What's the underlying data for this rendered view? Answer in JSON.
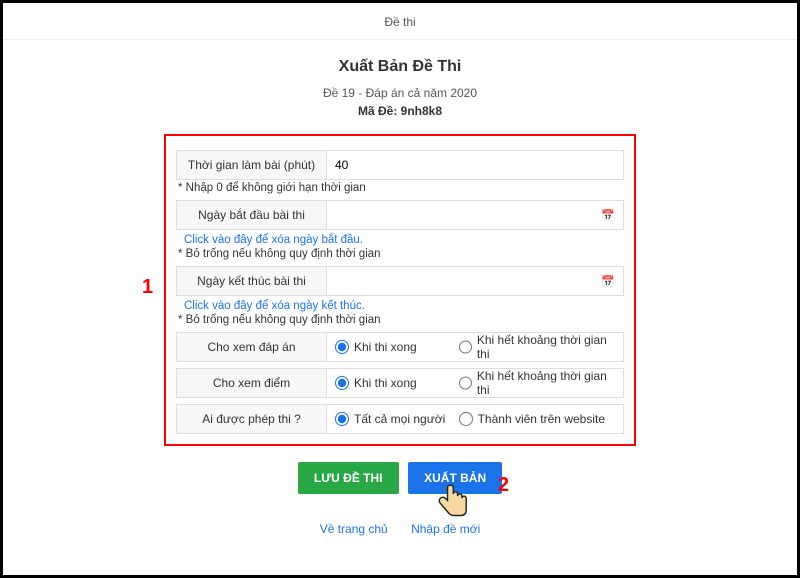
{
  "header": {
    "breadcrumb": "Đề thi"
  },
  "title": "Xuất Bản Đề Thi",
  "subtitle": "Đề 19 - Đáp án cả năm 2020",
  "exam_code_label": "Mã Đề:",
  "exam_code": "9nh8k8",
  "fields": {
    "duration": {
      "label": "Thời gian làm bài (phút)",
      "value": "40",
      "note": "* Nhập 0 để không giới hạn thời gian"
    },
    "start": {
      "label": "Ngày bắt đầu bài thi",
      "value": "",
      "clear_link": "Click vào đây để xóa ngày bắt đầu.",
      "note": "* Bỏ trống nếu không quy định thời gian"
    },
    "end": {
      "label": "Ngày kết thúc bài thi",
      "value": "",
      "clear_link": "Click vào đây để xóa ngày kết thúc.",
      "note": "* Bỏ trống nếu không quy định thời gian"
    },
    "show_answer": {
      "label": "Cho xem đáp án",
      "opt1": "Khi thi xong",
      "opt2": "Khi hết khoảng thời gian thi"
    },
    "show_score": {
      "label": "Cho xem điểm",
      "opt1": "Khi thi xong",
      "opt2": "Khi hết khoảng thời gian thi"
    },
    "who": {
      "label": "Ai được phép thi ?",
      "opt1": "Tất cả mọi người",
      "opt2": "Thành viên trên website"
    }
  },
  "buttons": {
    "save": "LƯU ĐỀ THI",
    "publish": "XUẤT BẢN"
  },
  "steps": {
    "one": "1",
    "two": "2"
  },
  "links": {
    "home": "Về trang chủ",
    "input_new": "Nhập đề mới"
  }
}
